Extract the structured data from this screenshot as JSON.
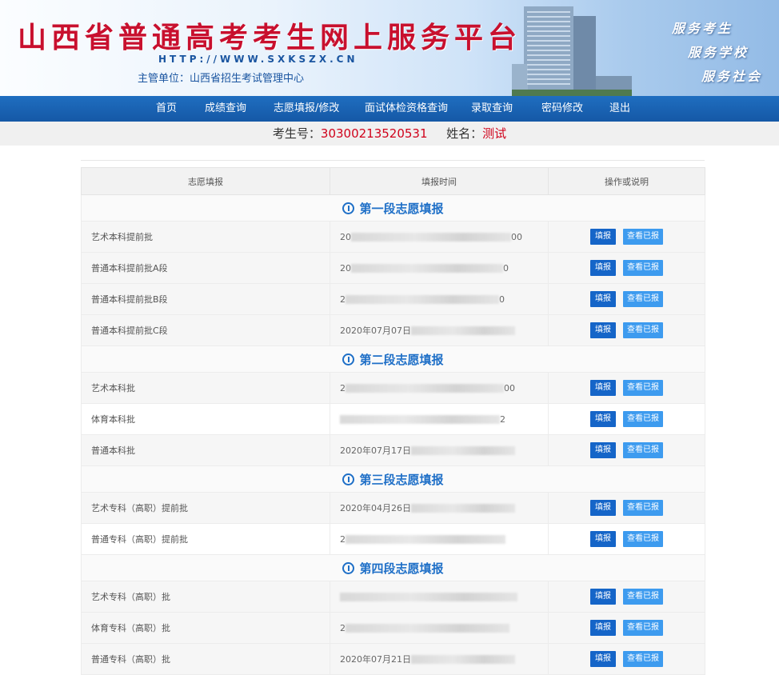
{
  "header": {
    "title": "山西省普通高考考生网上服务平台",
    "url": "HTTP://WWW.SXKSZX.CN",
    "organizer": "主管单位：山西省招生考试管理中心",
    "slogans": [
      "服务考生",
      "服务学校",
      "服务社会"
    ]
  },
  "nav": {
    "items": [
      {
        "label": "首页"
      },
      {
        "label": "成绩查询"
      },
      {
        "label": "志愿填报/修改"
      },
      {
        "label": "面试体检资格查询"
      },
      {
        "label": "录取查询"
      },
      {
        "label": "密码修改"
      },
      {
        "label": "退出"
      }
    ]
  },
  "student": {
    "id_label": "考生号：",
    "id_value": "30300213520531",
    "name_label": "姓名：",
    "name_value": "测试"
  },
  "table": {
    "headers": [
      "志愿填报",
      "填报时间",
      "操作或说明"
    ],
    "fill_label": "填报",
    "view_label": "查看已报",
    "sections": [
      {
        "title": "第一段志愿填报",
        "rows": [
          {
            "name": "艺术本科提前批",
            "time_prefix": "20",
            "time_suffix": "00"
          },
          {
            "name": "普通本科提前批A段",
            "time_prefix": "20",
            "time_suffix": "0"
          },
          {
            "name": "普通本科提前批B段",
            "time_prefix": "2",
            "time_suffix": "0"
          },
          {
            "name": "普通本科提前批C段",
            "time_prefix": "2020年07月07日",
            "time_suffix": ""
          }
        ]
      },
      {
        "title": "第二段志愿填报",
        "rows": [
          {
            "name": "艺术本科批",
            "time_prefix": "2",
            "time_suffix": "00"
          },
          {
            "name": "体育本科批",
            "time_prefix": "",
            "time_suffix": "2"
          },
          {
            "name": "普通本科批",
            "time_prefix": "2020年07月17日",
            "time_suffix": ""
          }
        ]
      },
      {
        "title": "第三段志愿填报",
        "rows": [
          {
            "name": "艺术专科（高职）提前批",
            "time_prefix": "2020年04月26日",
            "time_suffix": ""
          },
          {
            "name": "普通专科（高职）提前批",
            "time_prefix": "2",
            "time_suffix": ""
          }
        ]
      },
      {
        "title": "第四段志愿填报",
        "rows": [
          {
            "name": "艺术专科（高职）批",
            "time_prefix": "",
            "time_suffix": ""
          },
          {
            "name": "体育专科（高职）批",
            "time_prefix": "2",
            "time_suffix": ""
          },
          {
            "name": "普通专科（高职）批",
            "time_prefix": "2020年07月21日",
            "time_suffix": ""
          }
        ]
      }
    ]
  }
}
